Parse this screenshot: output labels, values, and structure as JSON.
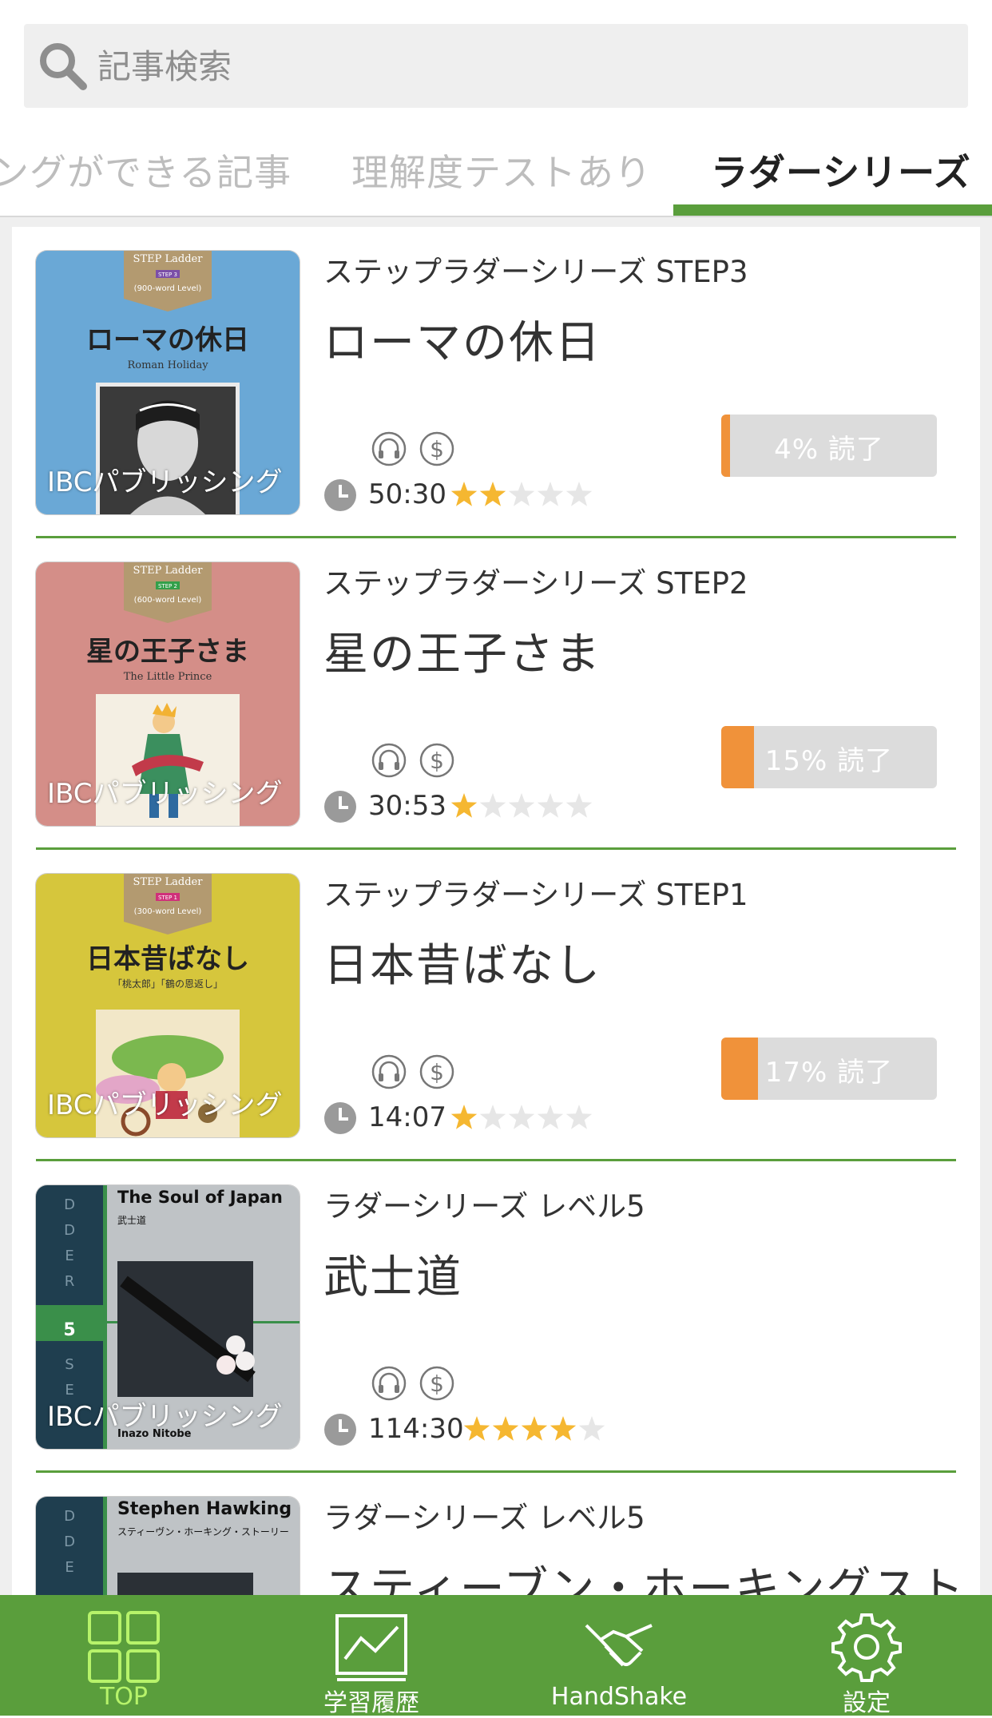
{
  "search": {
    "placeholder": "記事検索"
  },
  "tabs": [
    {
      "label": "ングができる記事",
      "active": false
    },
    {
      "label": "理解度テストあり",
      "active": false
    },
    {
      "label": "ラダーシリーズ",
      "active": true
    }
  ],
  "items": [
    {
      "cover": {
        "label": "STEP Ladder",
        "step": "STEP 3",
        "level": "(900-word Level)",
        "title": "ローマの休日",
        "subtitle": "Roman Holiday"
      },
      "publisher": "IBCパブリッシング",
      "series": "ステップラダーシリーズ STEP3",
      "title": "ローマの休日",
      "duration": "50:30",
      "rating": 2,
      "progress_percent": 4,
      "progress_label": "4% 読了"
    },
    {
      "cover": {
        "label": "STEP Ladder",
        "step": "STEP 2",
        "level": "(600-word Level)",
        "title": "星の王子さま",
        "subtitle": "The Little Prince"
      },
      "publisher": "IBCパブリッシング",
      "series": "ステップラダーシリーズ STEP2",
      "title": "星の王子さま",
      "duration": "30:53",
      "rating": 1,
      "progress_percent": 15,
      "progress_label": "15% 読了"
    },
    {
      "cover": {
        "label": "STEP Ladder",
        "step": "STEP 1",
        "level": "(300-word Level)",
        "title": "日本昔ばなし",
        "subtitle": "「桃太郎」「鶴の恩返し」"
      },
      "publisher": "IBCパブリッシング",
      "series": "ステップラダーシリーズ STEP1",
      "title": "日本昔ばなし",
      "duration": "14:07",
      "rating": 1,
      "progress_percent": 17,
      "progress_label": "17% 読了"
    },
    {
      "cover": {
        "title": "The Soul of Japan",
        "subtitle": "武士道",
        "level": "5",
        "author": "Inazo Nitobe"
      },
      "publisher": "IBCパブリッシング",
      "series": "ラダーシリーズ レベル5",
      "title": "武士道",
      "duration": "114:30",
      "rating": 4
    },
    {
      "cover": {
        "title": "Stephen Hawking",
        "subtitle": "スティーヴン・ホーキング・ストーリー"
      },
      "series": "ラダーシリーズ レベル5",
      "title": "スティーブン・ホーキングスト"
    }
  ],
  "nav": [
    {
      "label": "TOP",
      "icon": "grid-icon",
      "active": true
    },
    {
      "label": "学習履歴",
      "icon": "chart-icon",
      "active": false
    },
    {
      "label": "HandShake",
      "icon": "handshake-icon",
      "active": false
    },
    {
      "label": "設定",
      "icon": "gear-icon",
      "active": false
    }
  ],
  "colors": {
    "accent_green": "#5a9e3c",
    "progress_orange": "#f0923a",
    "star_gold": "#f5b731"
  }
}
